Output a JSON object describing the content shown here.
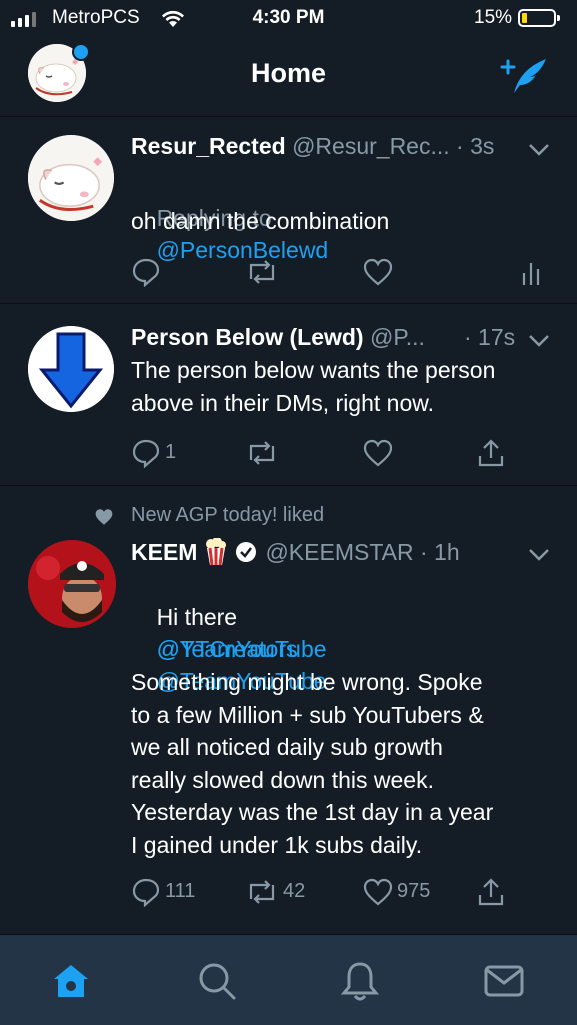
{
  "status_bar": {
    "carrier": "MetroPCS",
    "time": "4:30 PM",
    "battery": "15%",
    "battery_level": 0.15
  },
  "header": {
    "title": "Home"
  },
  "tweets": [
    {
      "display_name": "Resur_Rected",
      "handle_time": "@Resur_Rec... · 3s",
      "replying_label": "Replying to",
      "replying_to": "@PersonBelewd",
      "text": "oh damn the combination"
    },
    {
      "display_name": "Person Below (Lewd)",
      "handle": "@P...",
      "time": "· 17s",
      "text_line1": "The person below wants the person",
      "text_line2": "above in their DMs, right now.",
      "reply_count": "1"
    },
    {
      "liked_by": "New AGP today! liked",
      "display_name": "KEEM",
      "handle_time": "@KEEMSTAR · 1h",
      "text_prefix": "Hi there",
      "mention1": "@YTCreators",
      "mention2": "@TeamYouTube",
      "mention3": "@TeamYouTube",
      "body": "Something might be wrong. Spoke\nto a few Million + sub YouTubers &\nwe all noticed daily sub growth\nreally slowed down this week.\nYesterday was the 1st day in a year\nI gained under 1k subs daily.",
      "reply_count": "111",
      "retweet_count": "42",
      "like_count": "975"
    }
  ],
  "tabs": [
    "home",
    "search",
    "notifications",
    "messages"
  ],
  "colors": {
    "background": "#141d26",
    "accent": "#1da1f2",
    "muted": "#8899a6",
    "tabbar": "#243447"
  }
}
